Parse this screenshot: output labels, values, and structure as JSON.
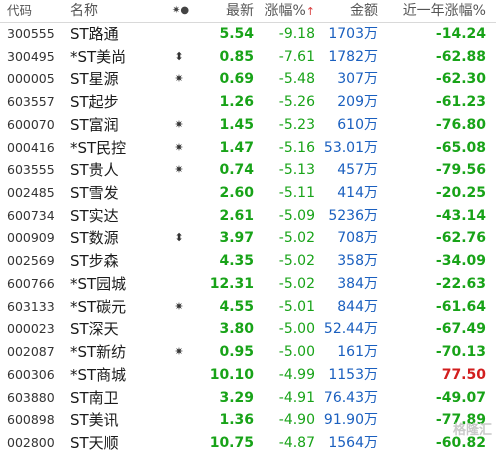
{
  "header": {
    "code": "代码",
    "name": "名称",
    "mark": "✷●",
    "price": "最新",
    "chg": "涨幅%",
    "sort_arrow": "↑",
    "amount": "金额",
    "year": "近一年涨幅%"
  },
  "rows": [
    {
      "code": "300555",
      "name": "ST路通",
      "mark": "",
      "price": "5.54",
      "chg": "-9.18",
      "amount": "1703",
      "unit": "万",
      "year": "-14.24",
      "year_up": false
    },
    {
      "code": "300495",
      "name": "*ST美尚",
      "mark": "⬍",
      "price": "0.85",
      "chg": "-7.61",
      "amount": "1782",
      "unit": "万",
      "year": "-62.88",
      "year_up": false
    },
    {
      "code": "000005",
      "name": "ST星源",
      "mark": "✷",
      "price": "0.69",
      "chg": "-5.48",
      "amount": "307",
      "unit": "万",
      "year": "-62.30",
      "year_up": false
    },
    {
      "code": "603557",
      "name": "ST起步",
      "mark": "",
      "price": "1.26",
      "chg": "-5.26",
      "amount": "209",
      "unit": "万",
      "year": "-61.23",
      "year_up": false
    },
    {
      "code": "600070",
      "name": "ST富润",
      "mark": "✷",
      "price": "1.45",
      "chg": "-5.23",
      "amount": "610",
      "unit": "万",
      "year": "-76.80",
      "year_up": false
    },
    {
      "code": "000416",
      "name": "*ST民控",
      "mark": "✷",
      "price": "1.47",
      "chg": "-5.16",
      "amount": "53.01",
      "unit": "万",
      "year": "-65.08",
      "year_up": false
    },
    {
      "code": "603555",
      "name": "ST贵人",
      "mark": "✷",
      "price": "0.74",
      "chg": "-5.13",
      "amount": "457",
      "unit": "万",
      "year": "-79.56",
      "year_up": false
    },
    {
      "code": "002485",
      "name": "ST雪发",
      "mark": "",
      "price": "2.60",
      "chg": "-5.11",
      "amount": "414",
      "unit": "万",
      "year": "-20.25",
      "year_up": false
    },
    {
      "code": "600734",
      "name": "ST实达",
      "mark": "",
      "price": "2.61",
      "chg": "-5.09",
      "amount": "5236",
      "unit": "万",
      "year": "-43.14",
      "year_up": false
    },
    {
      "code": "000909",
      "name": "ST数源",
      "mark": "⬍",
      "price": "3.97",
      "chg": "-5.02",
      "amount": "708",
      "unit": "万",
      "year": "-62.76",
      "year_up": false
    },
    {
      "code": "002569",
      "name": "ST步森",
      "mark": "",
      "price": "4.35",
      "chg": "-5.02",
      "amount": "358",
      "unit": "万",
      "year": "-34.09",
      "year_up": false
    },
    {
      "code": "600766",
      "name": "*ST园城",
      "mark": "",
      "price": "12.31",
      "chg": "-5.02",
      "amount": "384",
      "unit": "万",
      "year": "-22.63",
      "year_up": false
    },
    {
      "code": "603133",
      "name": "*ST碳元",
      "mark": "✷",
      "price": "4.55",
      "chg": "-5.01",
      "amount": "844",
      "unit": "万",
      "year": "-61.64",
      "year_up": false
    },
    {
      "code": "000023",
      "name": "ST深天",
      "mark": "",
      "price": "3.80",
      "chg": "-5.00",
      "amount": "52.44",
      "unit": "万",
      "year": "-67.49",
      "year_up": false
    },
    {
      "code": "002087",
      "name": "*ST新纺",
      "mark": "✷",
      "price": "0.95",
      "chg": "-5.00",
      "amount": "161",
      "unit": "万",
      "year": "-70.13",
      "year_up": false
    },
    {
      "code": "600306",
      "name": "*ST商城",
      "mark": "",
      "price": "10.10",
      "chg": "-4.99",
      "amount": "1153",
      "unit": "万",
      "year": "77.50",
      "year_up": true
    },
    {
      "code": "603880",
      "name": "ST南卫",
      "mark": "",
      "price": "3.29",
      "chg": "-4.91",
      "amount": "76.43",
      "unit": "万",
      "year": "-49.07",
      "year_up": false
    },
    {
      "code": "600898",
      "name": "ST美讯",
      "mark": "",
      "price": "1.36",
      "chg": "-4.90",
      "amount": "91.90",
      "unit": "万",
      "year": "-77.89",
      "year_up": false
    },
    {
      "code": "002800",
      "name": "ST天顺",
      "mark": "",
      "price": "10.75",
      "chg": "-4.87",
      "amount": "1564",
      "unit": "万",
      "year": "-60.82",
      "year_up": false
    }
  ],
  "watermark": "格隆汇",
  "colors": {
    "down": "#18a318",
    "up": "#d21e1e",
    "amount": "#1a5fbf"
  }
}
